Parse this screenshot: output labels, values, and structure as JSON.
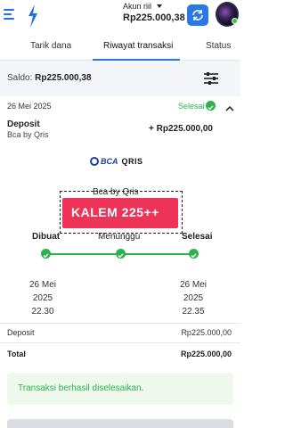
{
  "header": {
    "account_type": "Akun riil",
    "balance": "Rp225.000,38"
  },
  "tabs": [
    {
      "label": "Tarik dana",
      "active": false
    },
    {
      "label": "Riwayat transaksi",
      "active": true
    },
    {
      "label": "Status",
      "active": false
    }
  ],
  "saldo": {
    "label": "Saldo:",
    "value": "Rp225.000,38"
  },
  "transaction": {
    "date": "26 Mei 2025",
    "status": "Selesai",
    "title": "Deposit",
    "method": "Bca by Qris",
    "amount": "+ Rp225.000,00",
    "bank_logo_text": "BCA",
    "qris_logo_text": "QRIS",
    "channel": "Bca by Qris"
  },
  "promo": {
    "text": "KALEM 225++",
    "color": "#ee3358"
  },
  "steps": [
    {
      "label": "Dibuat",
      "date": "26 Mei",
      "year": "2025",
      "time": "22.30"
    },
    {
      "label": "Menunggu"
    },
    {
      "label": "Selesai",
      "date": "26 Mei",
      "year": "2025",
      "time": "22.35"
    }
  ],
  "summary": {
    "deposit_label": "Deposit",
    "deposit_value": "Rp225.000,00",
    "total_label": "Total",
    "total_value": "Rp225.000,00"
  },
  "success_message": "Transaksi berhasil diselesaikan.",
  "colors": {
    "accent": "#2a78e6",
    "success": "#2bb24c"
  }
}
